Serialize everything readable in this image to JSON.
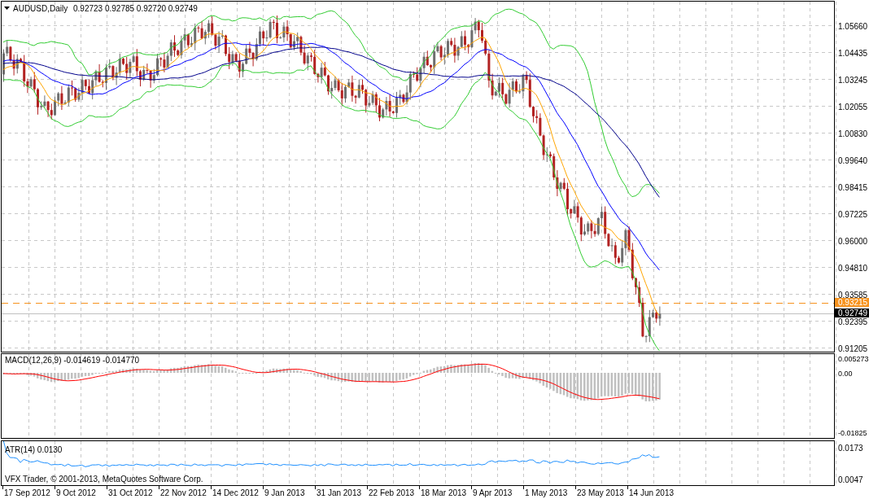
{
  "symbol": {
    "title": "AUDUSD,Daily",
    "ohlc": "0.92723 0.92785 0.92720 0.92749"
  },
  "price_axis": [
    "1.05660",
    "1.04435",
    "1.03245",
    "1.02055",
    "1.00830",
    "0.99640",
    "0.98415",
    "0.97225",
    "0.96000",
    "0.94810",
    "0.93585",
    "0.92395",
    "0.91205"
  ],
  "price_tags": [
    {
      "kind": "line",
      "value": "0.93215"
    },
    {
      "kind": "bid",
      "value": "0.92749"
    }
  ],
  "macd": {
    "label": "MACD(12,26,9) -0.014619 -0.014770",
    "axis": [
      "0.005273",
      "0.00",
      "-0.01825"
    ]
  },
  "atr": {
    "label": "ATR(14) 0.0130",
    "axis": [
      "0.0173",
      "0.0047"
    ]
  },
  "copyright": "VFX Trader, © 2001-2013, MetaQuotes Software Corp.",
  "time_axis": [
    "17 Sep 2012",
    "9 Oct 2012",
    "31 Oct 2012",
    "22 Nov 2012",
    "14 Dec 2012",
    "9 Jan 2013",
    "31 Jan 2013",
    "22 Feb 2013",
    "18 Mar 2013",
    "9 Apr 2013",
    "1 May 2013",
    "23 May 2013",
    "14 Jun 2013"
  ]
}
